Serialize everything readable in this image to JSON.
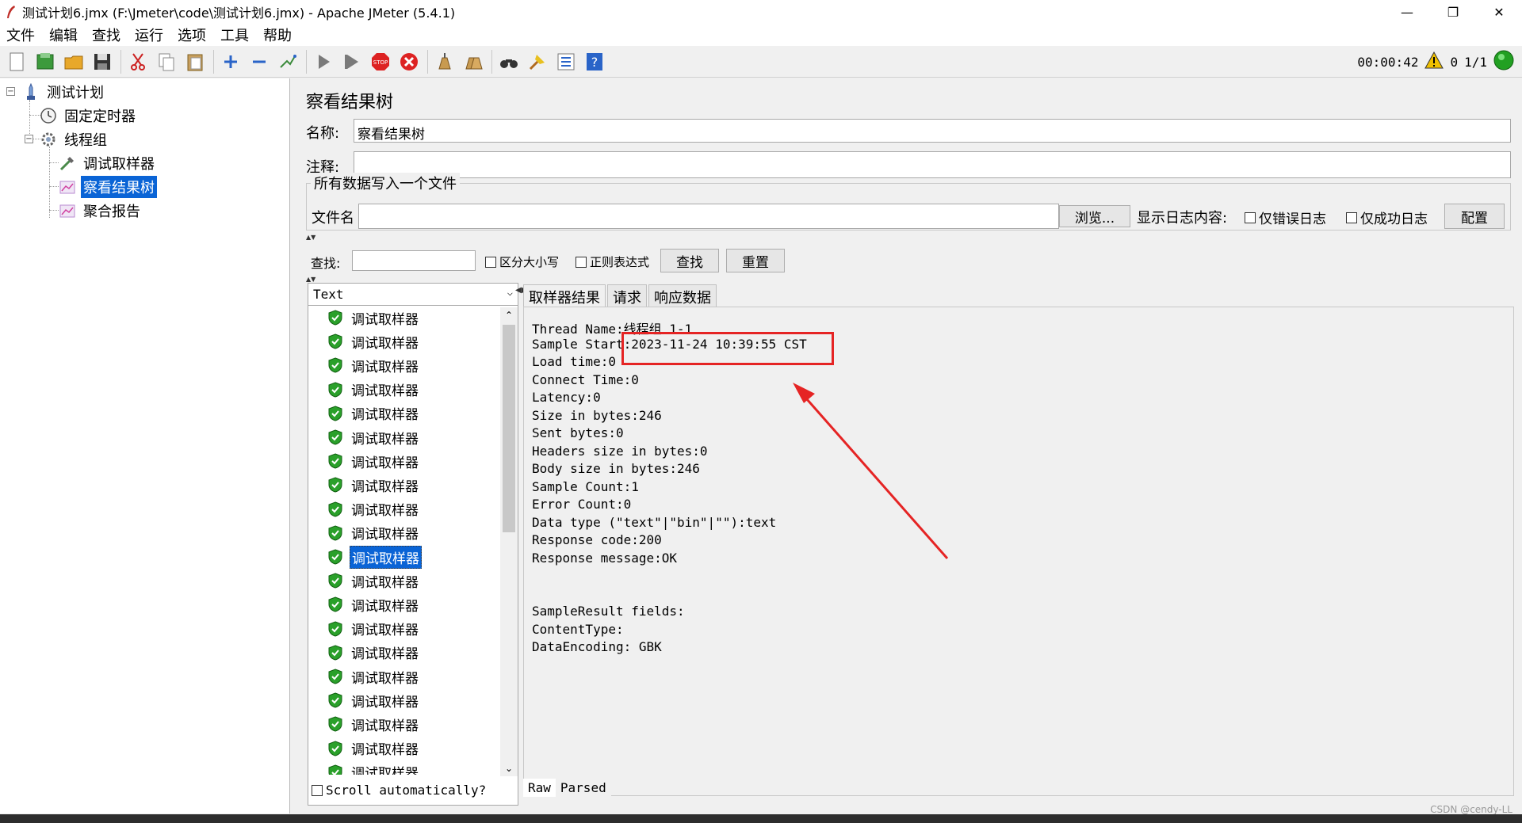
{
  "window": {
    "title": "测试计划6.jmx (F:\\Jmeter\\code\\测试计划6.jmx) - Apache JMeter (5.4.1)",
    "minimize": "—",
    "restore": "❐",
    "close": "✕"
  },
  "menu": [
    "文件",
    "编辑",
    "查找",
    "运行",
    "选项",
    "工具",
    "帮助"
  ],
  "toolbar": {
    "timer": "00:00:42",
    "warn_count": "0",
    "threads": "1/1",
    "colors": {
      "stop": "#d22",
      "run": "#22a022",
      "help": "#2a64c8"
    }
  },
  "tree": {
    "items": [
      {
        "label": "测试计划",
        "icon": "test-plan-icon"
      },
      {
        "label": "固定定时器",
        "icon": "timer-icon"
      },
      {
        "label": "线程组",
        "icon": "gear-icon"
      },
      {
        "label": "调试取样器",
        "icon": "sampler-icon"
      },
      {
        "label": "察看结果树",
        "icon": "chart-icon"
      },
      {
        "label": "聚合报告",
        "icon": "chart-icon"
      }
    ],
    "selected_index": 4
  },
  "panel": {
    "title": "察看结果树",
    "name_label": "名称:",
    "name_value": "察看结果树",
    "comment_label": "注释:",
    "comment_value": "",
    "file_group_title": "所有数据写入一个文件",
    "filename_label": "文件名",
    "filename_value": "",
    "browse_button": "浏览...",
    "log_display_label": "显示日志内容:",
    "errors_only": "仅错误日志",
    "success_only": "仅成功日志",
    "configure_button": "配置"
  },
  "search": {
    "label": "查找:",
    "value": "",
    "case_sensitive": "区分大小写",
    "regex": "正则表达式",
    "find_button": "查找",
    "reset_button": "重置"
  },
  "list": {
    "renderer": "Text",
    "item_label": "调试取样器",
    "items": [
      "调试取样器",
      "调试取样器",
      "调试取样器",
      "调试取样器",
      "调试取样器",
      "调试取样器",
      "调试取样器",
      "调试取样器",
      "调试取样器",
      "调试取样器",
      "调试取样器",
      "调试取样器",
      "调试取样器",
      "调试取样器",
      "调试取样器",
      "调试取样器",
      "调试取样器",
      "调试取样器",
      "调试取样器",
      "调试取样器"
    ],
    "selected_index": 10,
    "scroll_auto": "Scroll automatically?"
  },
  "result": {
    "tabs": [
      "取样器结果",
      "请求",
      "响应数据"
    ],
    "active_tab": 0,
    "lines": [
      "Thread Name:线程组 1-1",
      "Sample Start:2023-11-24 10:39:55 CST",
      "Load time:0",
      "Connect Time:0",
      "Latency:0",
      "Size in bytes:246",
      "Sent bytes:0",
      "Headers size in bytes:0",
      "Body size in bytes:246",
      "Sample Count:1",
      "Error Count:0",
      "Data type (\"text\"|\"bin\"|\"\"):text",
      "Response code:200",
      "Response message:OK",
      "",
      "",
      "SampleResult fields:",
      "ContentType:",
      "DataEncoding: GBK"
    ],
    "bottom_tabs": [
      "Raw",
      "Parsed"
    ],
    "annotation_color": "#e52424"
  },
  "watermark": "CSDN @cendy-LL"
}
